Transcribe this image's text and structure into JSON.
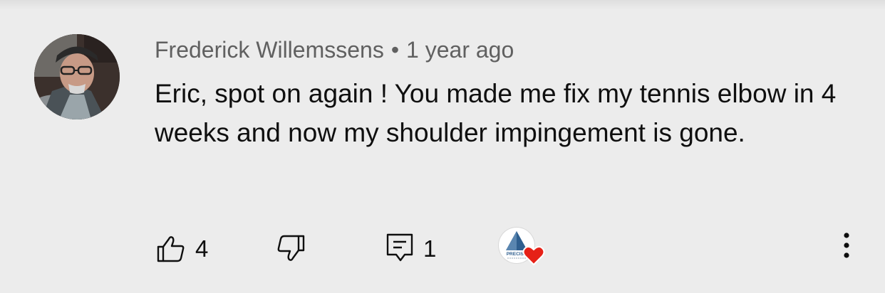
{
  "comment": {
    "author": "Frederick Willemssens",
    "separator": "•",
    "timestamp": "1 year ago",
    "text": "Eric, spot on again ! You made me fix my tennis elbow in 4 weeks and now my shoulder impingement is gone.",
    "like_count": "4",
    "reply_count": "1"
  },
  "creator_badge": {
    "logo_text": "PRECISE"
  },
  "icons": {
    "like": "thumbs-up-icon",
    "dislike": "thumbs-down-icon",
    "reply": "comment-icon",
    "heart": "heart-icon",
    "more": "vertical-dots-icon"
  },
  "colors": {
    "background": "#ececec",
    "text": "#0f0f0f",
    "meta": "#606060",
    "heart": "#e62117",
    "logo_blue": "#2f5f8f"
  }
}
